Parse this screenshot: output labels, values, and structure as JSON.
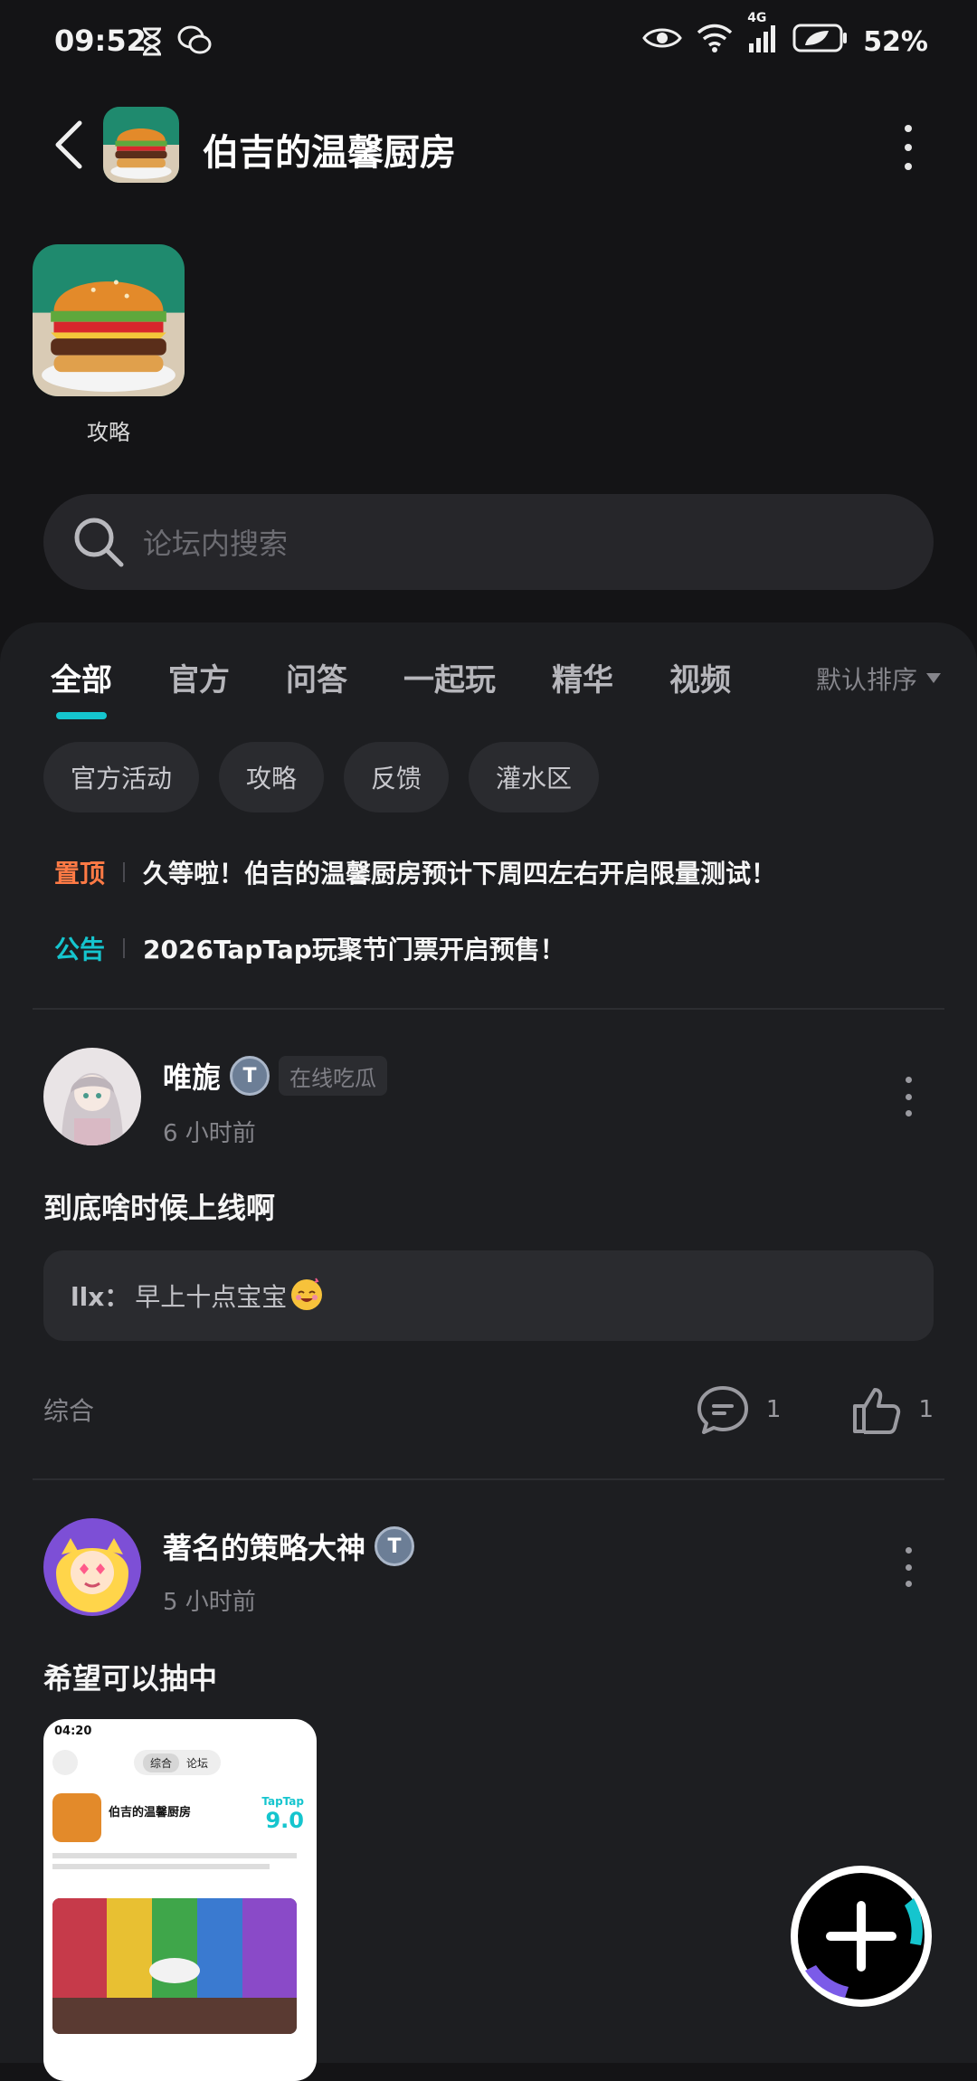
{
  "status_bar": {
    "time": "09:52",
    "battery": "52%",
    "network": "4G"
  },
  "header": {
    "title": "伯吉的温馨厨房"
  },
  "shortcuts": [
    {
      "label": "攻略"
    }
  ],
  "search": {
    "placeholder": "论坛内搜索"
  },
  "tabs": [
    {
      "label": "全部",
      "active": true
    },
    {
      "label": "官方"
    },
    {
      "label": "问答"
    },
    {
      "label": "一起玩"
    },
    {
      "label": "精华"
    },
    {
      "label": "视频"
    }
  ],
  "sort": {
    "label": "默认排序"
  },
  "chips": [
    "官方活动",
    "攻略",
    "反馈",
    "灌水区"
  ],
  "pinned": [
    {
      "tag": "置顶",
      "color": "#ff7a45",
      "text": "久等啦！伯吉的温馨厨房预计下周四左右开启限量测试！"
    },
    {
      "tag": "公告",
      "color": "#15c5ce",
      "text": "2026TapTap玩聚节门票开启预售！"
    }
  ],
  "posts": [
    {
      "username": "唯旎",
      "title_tag": "在线吃瓜",
      "time": "6  小时前",
      "text": "到底啥时候上线啊",
      "reply_user": "llx：",
      "reply_text": "早上十点宝宝",
      "category": "综合",
      "comments": "1",
      "likes": "1"
    },
    {
      "username": "著名的策略大神",
      "time": "5  小时前",
      "text": "希望可以抽中"
    }
  ],
  "screenshot": {
    "time": "04:20",
    "tab_active": "综合",
    "tab_other": "论坛",
    "game_title": "伯吉的温馨厨房",
    "brand": "TapTap",
    "score": "9.0"
  },
  "colors": {
    "accent": "#15c5ce",
    "pin": "#ff7a45",
    "background": "#141416",
    "panel": "#1d1e21"
  }
}
